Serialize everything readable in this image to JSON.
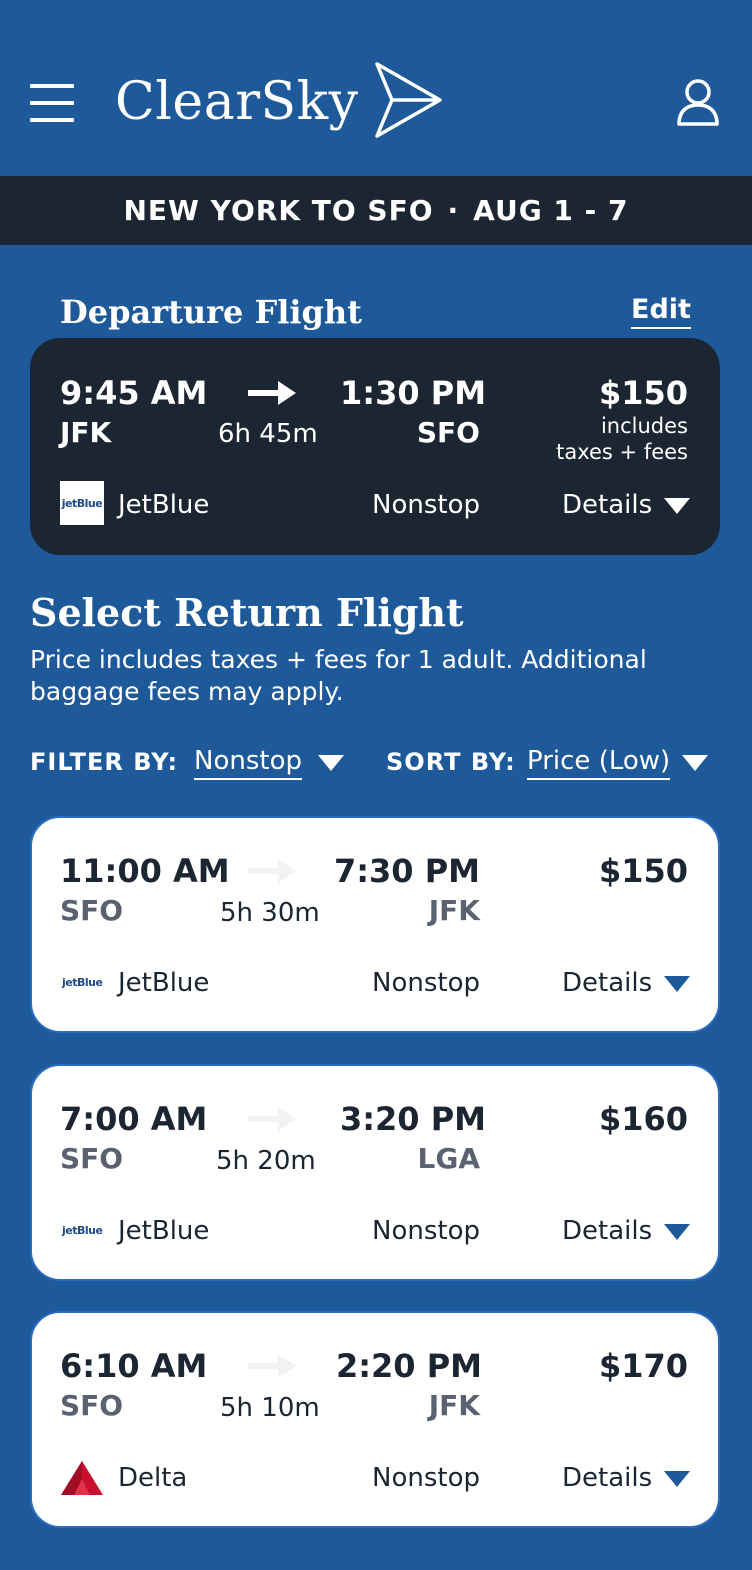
{
  "app": {
    "name": "ClearSky"
  },
  "route_bar": {
    "route": "NEW YORK TO SFO",
    "separator": "·",
    "dates": "AUG 1 - 7"
  },
  "departure": {
    "title": "Departure Flight",
    "edit_label": "Edit",
    "depart_time": "9:45 AM",
    "depart_code": "JFK",
    "duration": "6h 45m",
    "arrive_time": "1:30 PM",
    "arrive_code": "SFO",
    "price": "$150",
    "price_note_1": "includes",
    "price_note_2": "taxes + fees",
    "airline_logo_text": "jetBlue",
    "airline": "JetBlue",
    "stops": "Nonstop",
    "details_label": "Details"
  },
  "return": {
    "title": "Select Return Flight",
    "subtitle": "Price includes taxes + fees for 1 adult. Additional baggage fees may apply.",
    "filter_label": "FILTER BY:",
    "filter_value": "Nonstop",
    "sort_label": "SORT BY:",
    "sort_value": "Price (Low)",
    "flights": [
      {
        "depart_time": "11:00 AM",
        "depart_code": "SFO",
        "duration": "5h 30m",
        "arrive_time": "7:30 PM",
        "arrive_code": "JFK",
        "price": "$150",
        "airline_logo": "jetblue-logo",
        "airline_logo_text": "jetBlue",
        "airline": "JetBlue",
        "stops": "Nonstop",
        "details_label": "Details"
      },
      {
        "depart_time": "7:00 AM",
        "depart_code": "SFO",
        "duration": "5h 20m",
        "arrive_time": "3:20 PM",
        "arrive_code": "LGA",
        "price": "$160",
        "airline_logo": "jetblue-logo",
        "airline_logo_text": "jetBlue",
        "airline": "JetBlue",
        "stops": "Nonstop",
        "details_label": "Details"
      },
      {
        "depart_time": "6:10 AM",
        "depart_code": "SFO",
        "duration": "5h 10m",
        "arrive_time": "2:20 PM",
        "arrive_code": "JFK",
        "price": "$170",
        "airline_logo": "delta-logo",
        "airline": "Delta",
        "stops": "Nonstop",
        "details_label": "Details"
      }
    ]
  },
  "colors": {
    "brand_blue": "#1e5a9a",
    "dark_navy": "#1c2532",
    "card_border": "#2a6cc0",
    "delta_red": "#c8102e"
  },
  "icons": [
    "menu-icon",
    "paper-plane-icon",
    "user-icon",
    "arrow-right-icon",
    "chevron-down-icon"
  ]
}
